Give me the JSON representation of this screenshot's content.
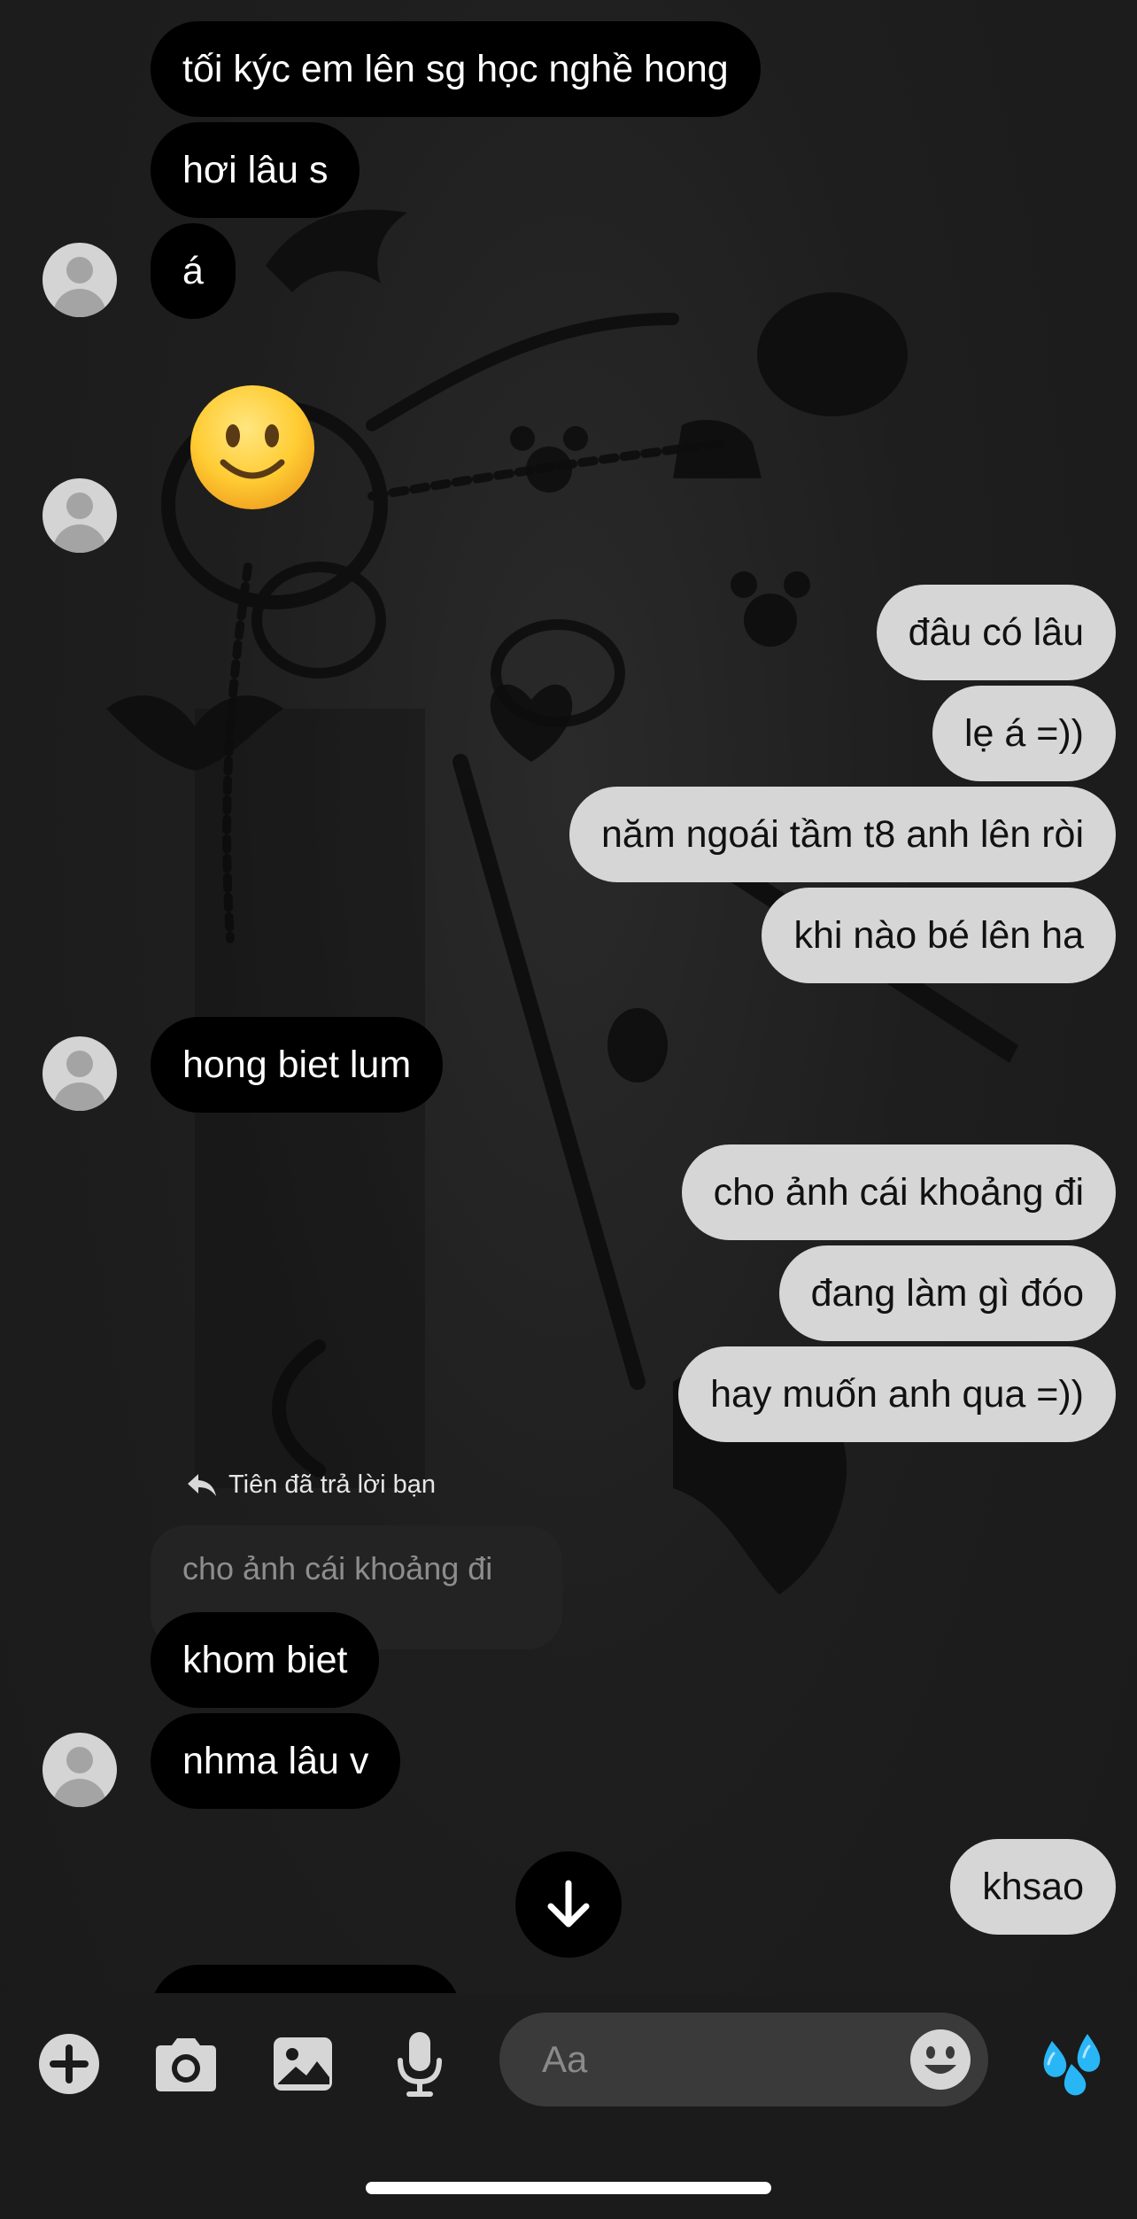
{
  "messages": {
    "m1": "tối kýc em lên sg học nghề hong",
    "m2": "hơi lâu s",
    "m3": "á",
    "m4": "🙂",
    "m5": "đâu có lâu",
    "m6": "lẹ á =))",
    "m7": "năm ngoái tầm t8 anh lên ròi",
    "m8": "khi nào bé lên ha",
    "m9": "hong biet lum",
    "m10": "cho ảnh cái khoảng đi",
    "m11": "đang làm gì đóo",
    "m12": "hay muốn anh qua =))",
    "m13": "khom biet",
    "m14": "nhma lâu v",
    "m15": "khsao"
  },
  "reply": {
    "label": "Tiên đã trả lời bạn",
    "quoted": "cho ảnh cái khoảng đi"
  },
  "composer": {
    "placeholder": "Aa",
    "icons": [
      "plus-icon",
      "camera-icon",
      "gallery-icon",
      "microphone-icon",
      "emoji-icon",
      "droplets-icon"
    ]
  },
  "icons": {
    "scroll": "arrow-down-icon",
    "reply": "reply-arrow-icon",
    "avatar": "default-avatar-icon"
  },
  "colors": {
    "background": "#1e1e1e",
    "incoming_bubble": "#000000",
    "outgoing_bubble": "#d6d6d6",
    "composer_input": "#3a3a3a",
    "send_icon": "#29b6f6"
  }
}
